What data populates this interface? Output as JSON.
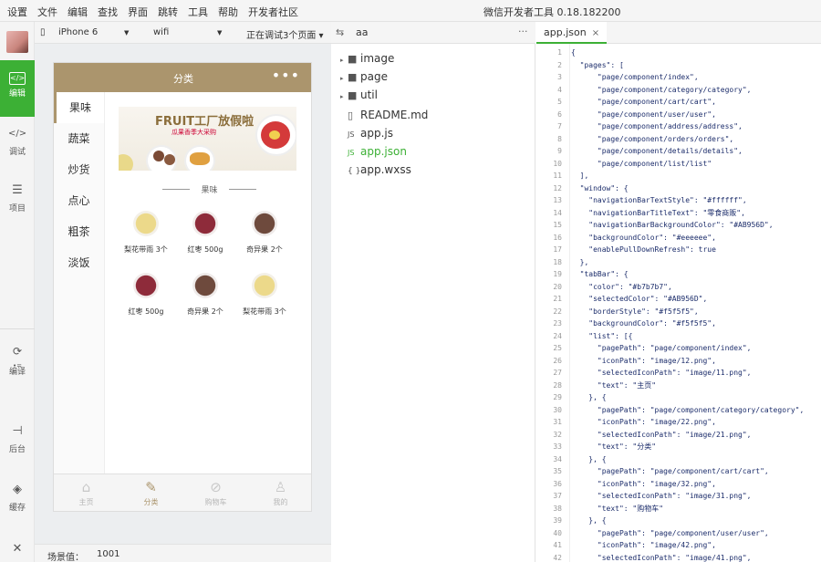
{
  "menubar": {
    "items": [
      "设置",
      "文件",
      "编辑",
      "查找",
      "界面",
      "跳转",
      "工具",
      "帮助",
      "开发者社区"
    ],
    "window_title": "微信开发者工具 0.18.182200"
  },
  "leftbar": {
    "buttons": [
      {
        "icon": "code-icon",
        "label": "编辑",
        "active": true
      },
      {
        "icon": "debug-icon",
        "label": "调试"
      },
      {
        "icon": "project-icon",
        "label": "项目"
      },
      {
        "icon": "compile-icon",
        "label": "编译"
      },
      {
        "icon": "backend-icon",
        "label": "后台"
      },
      {
        "icon": "cache-icon",
        "label": "缓存"
      }
    ]
  },
  "simulator": {
    "device": "iPhone 6",
    "network": "wifi",
    "debug_status": "正在调试3个页面 ▾",
    "scene_label": "场景值：",
    "scene_value": "1001"
  },
  "app": {
    "nav_title": "分类",
    "nav_more": "•••",
    "categories": [
      "果味",
      "蔬菜",
      "炒货",
      "点心",
      "粗茶",
      "淡饭"
    ],
    "banner_title": "FRUIT工厂放假啦",
    "banner_subtitle": "瓜果香季大采购",
    "section_title": "果味",
    "products": [
      {
        "name": "梨花带雨 3个",
        "color": "#e9d98a"
      },
      {
        "name": "红枣 500g",
        "color": "#8e2b3a"
      },
      {
        "name": "奇异果 2个",
        "color": "#6e4a3d"
      },
      {
        "name": "红枣 500g",
        "color": "#8e2b3a"
      },
      {
        "name": "奇异果 2个",
        "color": "#6e4a3d"
      },
      {
        "name": "梨花带雨 3个",
        "color": "#e9d98a"
      }
    ],
    "tabs": [
      {
        "icon": "home-icon",
        "label": "主页"
      },
      {
        "icon": "category-icon",
        "label": "分类",
        "selected": true
      },
      {
        "icon": "cart-icon",
        "label": "购物车"
      },
      {
        "icon": "user-icon",
        "label": "我的"
      }
    ]
  },
  "filetree": {
    "project": "aa",
    "more": "···",
    "items": [
      {
        "type": "folder",
        "name": "image"
      },
      {
        "type": "folder",
        "name": "page"
      },
      {
        "type": "folder",
        "name": "util"
      },
      {
        "type": "md",
        "name": "README.md"
      },
      {
        "type": "js",
        "name": "app.js"
      },
      {
        "type": "json",
        "name": "app.json",
        "active": true
      },
      {
        "type": "wxss",
        "name": "app.wxss"
      }
    ]
  },
  "editor": {
    "tab_label": "app.json",
    "tab_close": "×",
    "lines": [
      "{",
      "  \"pages\": [",
      "      \"page/component/index\",",
      "      \"page/component/category/category\",",
      "      \"page/component/cart/cart\",",
      "      \"page/component/user/user\",",
      "      \"page/component/address/address\",",
      "      \"page/component/orders/orders\",",
      "      \"page/component/details/details\",",
      "      \"page/component/list/list\"",
      "  ],",
      "  \"window\": {",
      "    \"navigationBarTextStyle\": \"#ffffff\",",
      "    \"navigationBarTitleText\": \"零食商贩\",",
      "    \"navigationBarBackgroundColor\": \"#AB956D\",",
      "    \"backgroundColor\": \"#eeeeee\",",
      "    \"enablePullDownRefresh\": true",
      "  },",
      "  \"tabBar\": {",
      "    \"color\": \"#b7b7b7\",",
      "    \"selectedColor\": \"#AB956D\",",
      "    \"borderStyle\": \"#f5f5f5\",",
      "    \"backgroundColor\": \"#f5f5f5\",",
      "    \"list\": [{",
      "      \"pagePath\": \"page/component/index\",",
      "      \"iconPath\": \"image/12.png\",",
      "      \"selectedIconPath\": \"image/11.png\",",
      "      \"text\": \"主页\"",
      "    }, {",
      "      \"pagePath\": \"page/component/category/category\",",
      "      \"iconPath\": \"image/22.png\",",
      "      \"selectedIconPath\": \"image/21.png\",",
      "      \"text\": \"分类\"",
      "    }, {",
      "      \"pagePath\": \"page/component/cart/cart\",",
      "      \"iconPath\": \"image/32.png\",",
      "      \"selectedIconPath\": \"image/31.png\",",
      "      \"text\": \"购物车\"",
      "    }, {",
      "      \"pagePath\": \"page/component/user/user\",",
      "      \"iconPath\": \"image/42.png\",",
      "      \"selectedIconPath\": \"image/41.png\","
    ]
  }
}
